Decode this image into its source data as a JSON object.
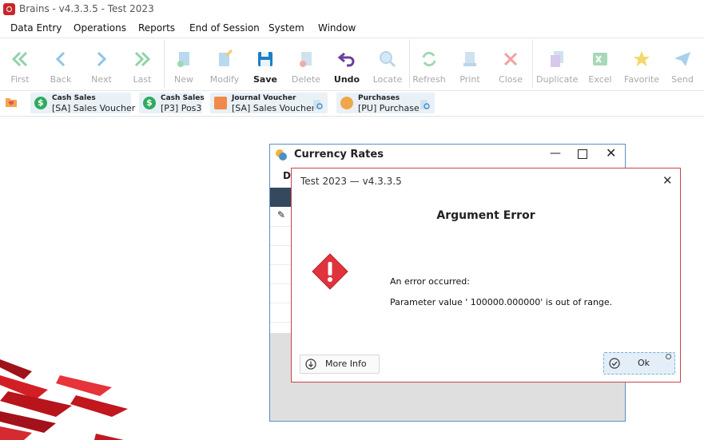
{
  "app": {
    "title": "Brains - v4.3.3.5 - Test 2023"
  },
  "menu": [
    "Data Entry",
    "Operations",
    "Reports",
    "End of Session",
    "System",
    "Window"
  ],
  "toolbar": {
    "first": "First",
    "back": "Back",
    "next": "Next",
    "last": "Last",
    "new": "New",
    "modify": "Modify",
    "save": "Save",
    "delete": "Delete",
    "undo": "Undo",
    "locate": "Locate",
    "refresh": "Refresh",
    "print": "Print",
    "close": "Close",
    "duplicate": "Duplicate",
    "excel": "Excel",
    "favorite": "Favorite",
    "send": "Send"
  },
  "shortcuts": [
    {
      "title": "Cash Sales",
      "subtitle": "[SA] Sales Voucher"
    },
    {
      "title": "Cash Sales",
      "subtitle": "[P3] Pos3"
    },
    {
      "title": "Journal Voucher",
      "subtitle": "[SA] Sales Voucher"
    },
    {
      "title": "Purchases",
      "subtitle": "[PU] Purchase"
    }
  ],
  "currency_window": {
    "title": "Currency Rates",
    "tab_label_partial": "Da"
  },
  "error_dialog": {
    "title": "Test 2023 — v4.3.3.5",
    "heading": "Argument Error",
    "message_line1": "An error occurred:",
    "message_line2": "Parameter value '  100000.000000' is out of range.",
    "more_info_label": "More Info",
    "ok_label": "Ok"
  },
  "colors": {
    "accent_red": "#c8262b",
    "dialog_border": "#c8434d",
    "window_border": "#5d8fc2",
    "grid_header": "#34495e"
  }
}
